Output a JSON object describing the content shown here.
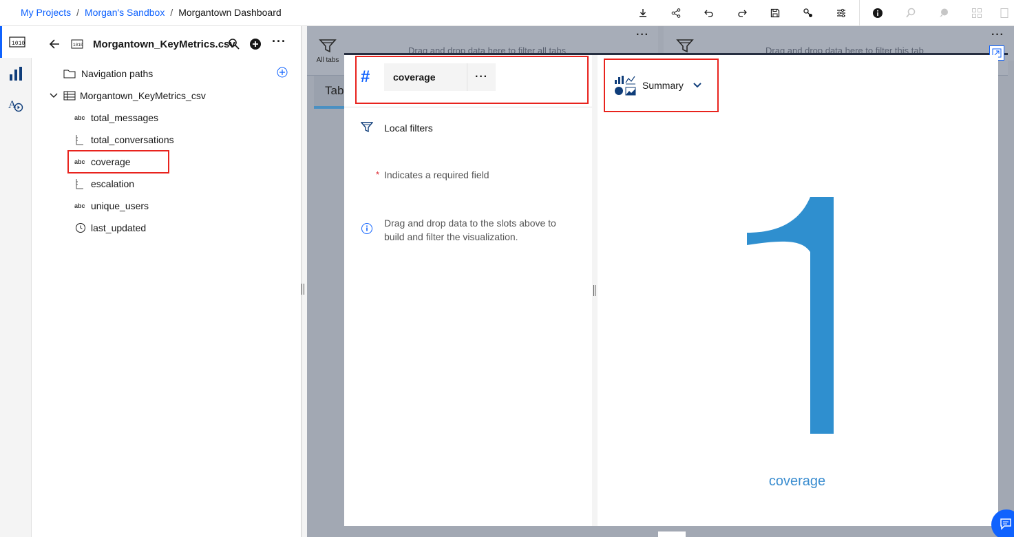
{
  "breadcrumb": {
    "items": [
      "My Projects",
      "Morgan's Sandbox",
      "Morgantown Dashboard"
    ]
  },
  "toolbar": {
    "icons": [
      "download-icon",
      "share-icon",
      "undo-icon",
      "redo-icon",
      "save-icon",
      "pin-icon",
      "settings-icon",
      "info-icon",
      "assistant-icon",
      "chat-icon",
      "widgets-icon"
    ]
  },
  "datapanel": {
    "title": "Morgantown_KeyMetrics.csv",
    "tree": [
      {
        "label": "Navigation paths",
        "icon": "folder-icon"
      },
      {
        "label": "Morgantown_KeyMetrics_csv",
        "icon": "table-icon"
      },
      {
        "label": "total_messages",
        "icon": "abc"
      },
      {
        "label": "total_conversations",
        "icon": "measure-icon"
      },
      {
        "label": "coverage",
        "icon": "abc"
      },
      {
        "label": "escalation",
        "icon": "measure-icon"
      },
      {
        "label": "unique_users",
        "icon": "abc"
      },
      {
        "label": "last_updated",
        "icon": "clock-icon"
      }
    ],
    "abc_glyph": "abc"
  },
  "canvas": {
    "filter_all_tabs_label": "All tabs",
    "drop_all_tabs": "Drag and drop data here to filter all tabs",
    "drop_this_tab": "Drag and drop data here to filter this tab",
    "tab_label": "Tab"
  },
  "slots": {
    "hash": "#",
    "field_name": "coverage",
    "more": "···",
    "local_filters": "Local filters",
    "required_star": "*",
    "required_text": "Indicates a required field",
    "info_text_1": "Drag and drop data to the slots above to",
    "info_text_2": "build and filter the visualization."
  },
  "viz": {
    "type_label": "Summary",
    "value": "1",
    "field_label": "coverage",
    "value_color": "#2f8fcf"
  }
}
